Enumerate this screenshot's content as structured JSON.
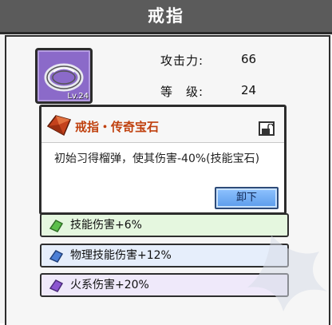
{
  "window": {
    "title": "戒指"
  },
  "item": {
    "level_badge": "Lv.24",
    "icon": "ring-icon"
  },
  "stats": [
    {
      "label": "攻击力:",
      "value": "66"
    },
    {
      "label": "等　级:",
      "value": "24"
    }
  ],
  "popup": {
    "title": "戒指・传奇宝石",
    "description": "初始习得榴弹，使其伤害-40%(技能宝石)",
    "unload_button": "卸下",
    "gem_icon": "red-gem-icon",
    "lock_icon": "lock-icon"
  },
  "attributes": [
    {
      "text": "技能伤害+6%",
      "color": "#5bbf4a",
      "icon": "green-gem-icon"
    },
    {
      "text": "物理技能伤害+12%",
      "color": "#4c7fd6",
      "icon": "blue-gem-icon"
    },
    {
      "text": "火系伤害+20%",
      "color": "#8b55d0",
      "icon": "purple-gem-icon"
    }
  ]
}
